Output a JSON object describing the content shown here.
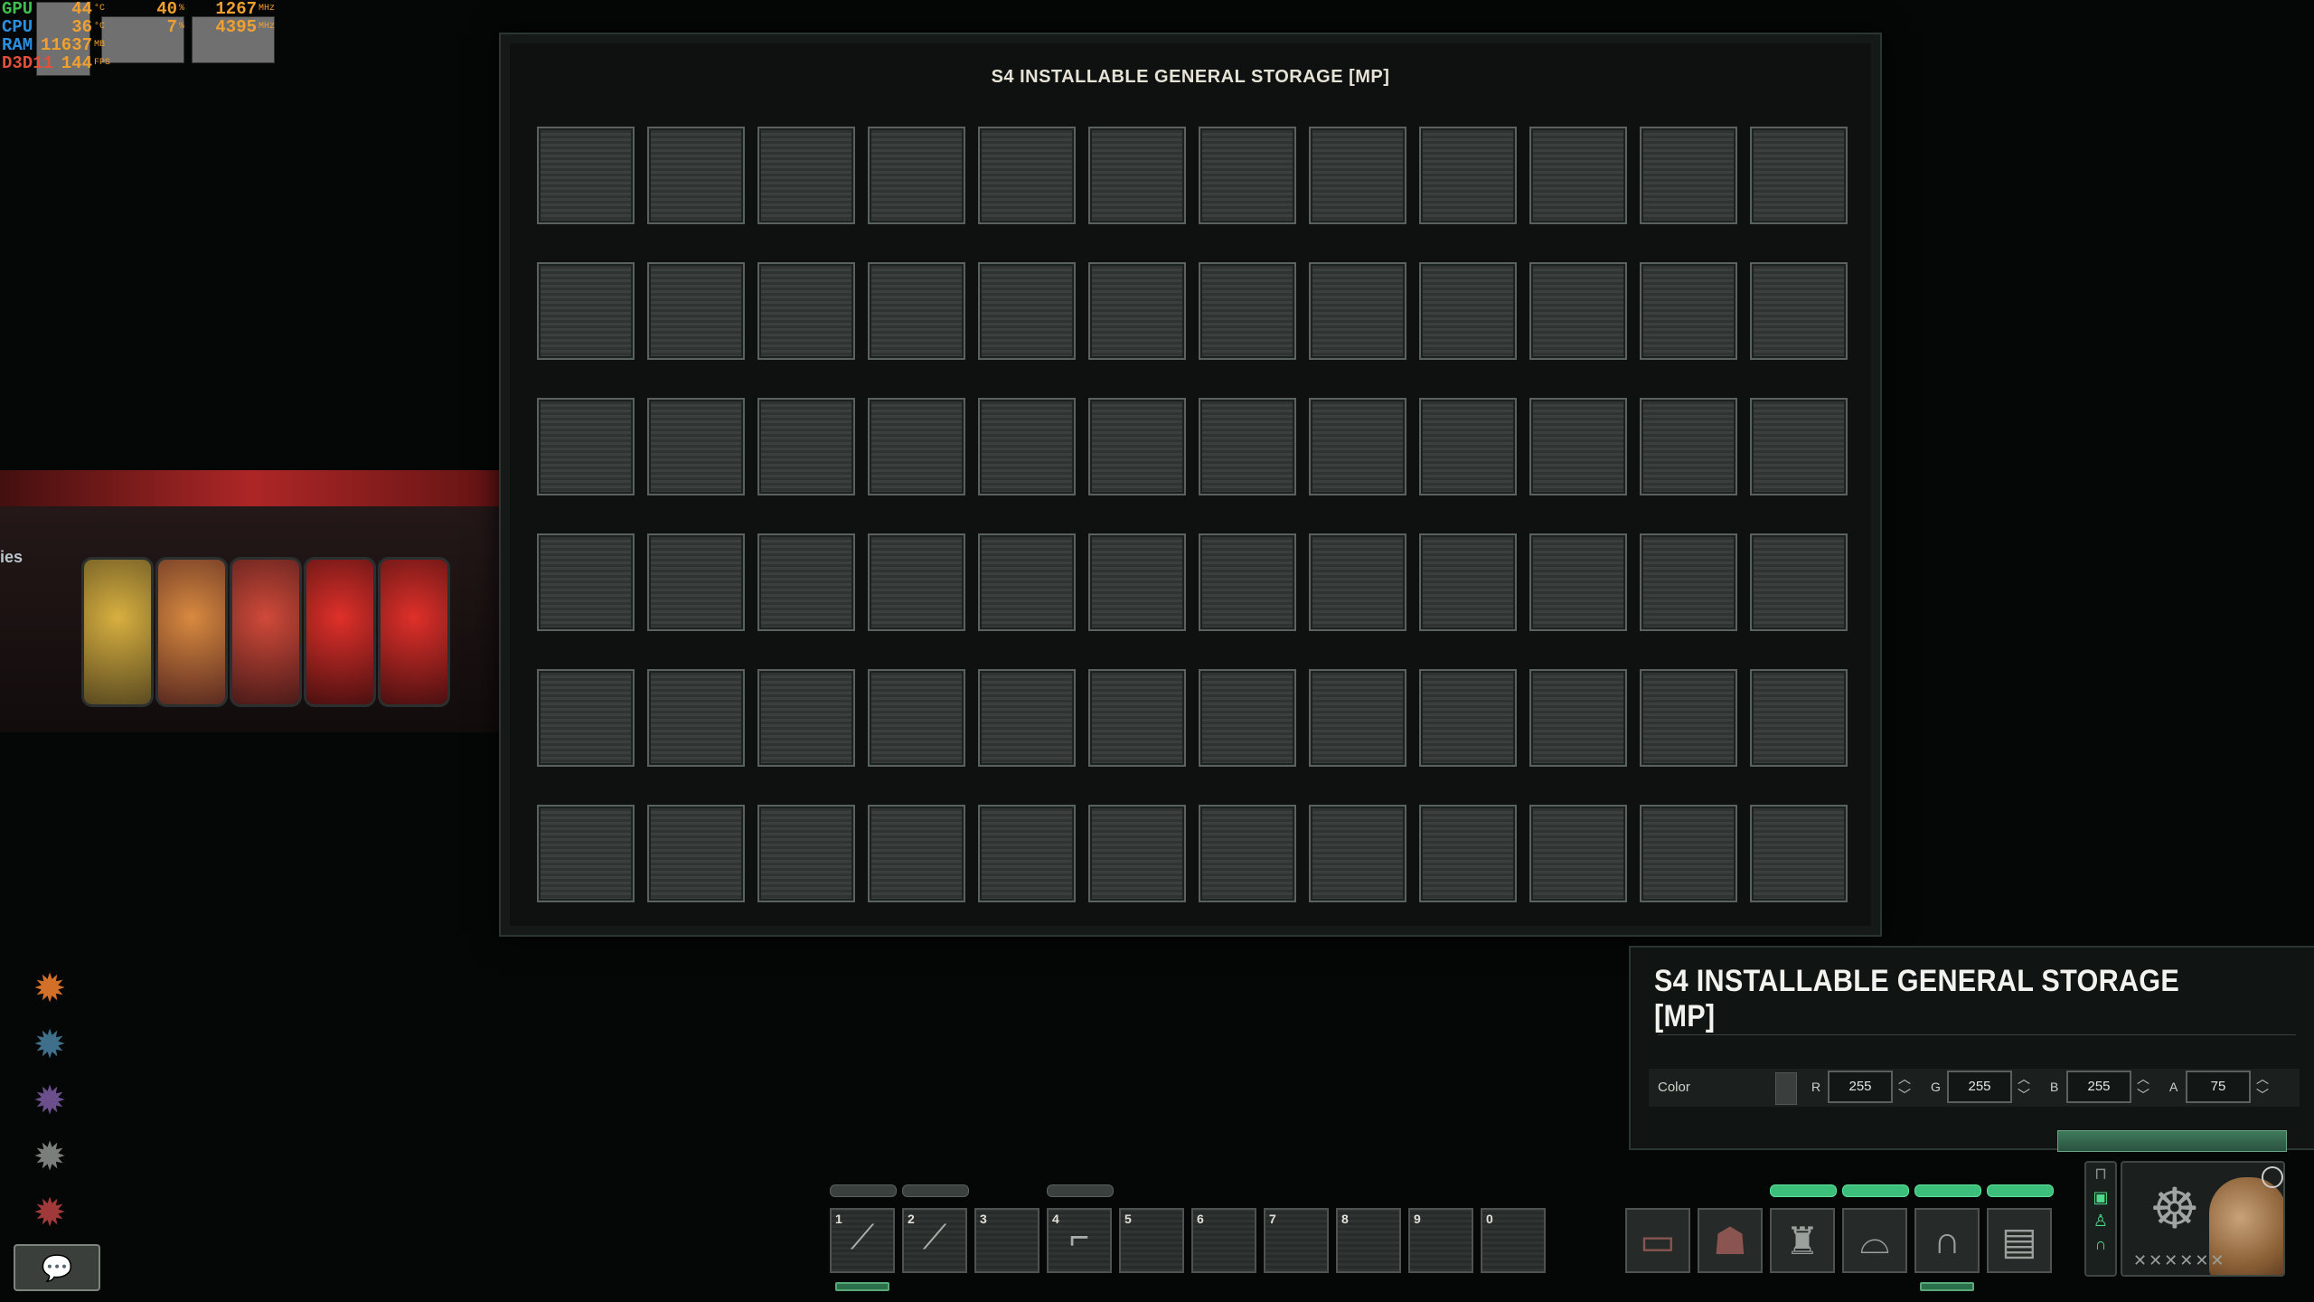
{
  "hw_overlay": {
    "rows": [
      {
        "label": "GPU",
        "label_color": "#3fbf4f",
        "v1": "44",
        "u1": "°C",
        "v2": "40",
        "u2": "%",
        "v3": "1267",
        "u3": "MHz"
      },
      {
        "label": "CPU",
        "label_color": "#2a8fe0",
        "v1": "36",
        "u1": "°C",
        "v2": "7",
        "u2": "%",
        "v3": "4395",
        "u3": "MHz"
      },
      {
        "label": "RAM",
        "label_color": "#2a8fe0",
        "v1": "11637",
        "u1": "MB",
        "v2": "",
        "u2": "",
        "v3": "",
        "u3": ""
      },
      {
        "label": "D3D11",
        "label_color": "#e0503a",
        "v1": "144",
        "u1": "FPS",
        "v2": "",
        "u2": "",
        "v3": "",
        "u3": ""
      }
    ]
  },
  "scene": {
    "fragment_text": "ies"
  },
  "storage_window": {
    "title": "S4 INSTALLABLE GENERAL STORAGE [MP]",
    "columns": 12,
    "rows": 6
  },
  "side_actions": [
    {
      "name": "fire-ability-icon",
      "glyph": "✹",
      "color": "#d2702a"
    },
    {
      "name": "combat-ability-icon",
      "glyph": "✹",
      "color": "#3f6f8a"
    },
    {
      "name": "psychic-ability-icon",
      "glyph": "✹",
      "color": "#6a4f8c"
    },
    {
      "name": "engineering-ability-icon",
      "glyph": "✹",
      "color": "#7a7f7c"
    },
    {
      "name": "medical-ability-icon",
      "glyph": "✹",
      "color": "#a03a3a"
    }
  ],
  "chat_icon": "💬",
  "info_panel": {
    "title": "S4 INSTALLABLE GENERAL STORAGE [MP]",
    "color_label": "Color",
    "channels": [
      {
        "label": "R",
        "value": "255"
      },
      {
        "label": "G",
        "value": "255"
      },
      {
        "label": "B",
        "value": "255"
      },
      {
        "label": "A",
        "value": "75"
      }
    ]
  },
  "hotbar": [
    {
      "num": "1",
      "icon": "rifle-icon",
      "glyph": "⟋"
    },
    {
      "num": "2",
      "icon": "wrench-icon",
      "glyph": "⟋"
    },
    {
      "num": "3",
      "icon": "",
      "glyph": ""
    },
    {
      "num": "4",
      "icon": "pistol-icon",
      "glyph": "⌐"
    },
    {
      "num": "5",
      "icon": "",
      "glyph": ""
    },
    {
      "num": "6",
      "icon": "",
      "glyph": ""
    },
    {
      "num": "7",
      "icon": "",
      "glyph": ""
    },
    {
      "num": "8",
      "icon": "",
      "glyph": ""
    },
    {
      "num": "9",
      "icon": "",
      "glyph": ""
    },
    {
      "num": "0",
      "icon": "",
      "glyph": ""
    }
  ],
  "equipment": [
    {
      "name": "bag-slot",
      "icon": "bag-icon",
      "glyph": "▭",
      "color": "#8a5550"
    },
    {
      "name": "head-slot",
      "icon": "helmet-icon",
      "glyph": "☗",
      "color": "#8a5550"
    },
    {
      "name": "body-slot",
      "icon": "jacket-icon",
      "glyph": "♜",
      "color": "#9aa09c"
    },
    {
      "name": "hat-slot",
      "icon": "cap-icon",
      "glyph": "⌓",
      "color": "#9aa09c"
    },
    {
      "name": "headset-slot",
      "icon": "headset-icon",
      "glyph": "∩",
      "color": "#9aa09c"
    },
    {
      "name": "id-card-slot",
      "icon": "id-card-icon",
      "glyph": "▤",
      "color": "#9aa09c"
    }
  ],
  "portrait": {
    "job_glyph": "☸",
    "rank_glyphs": "✕✕✕✕✕✕"
  }
}
